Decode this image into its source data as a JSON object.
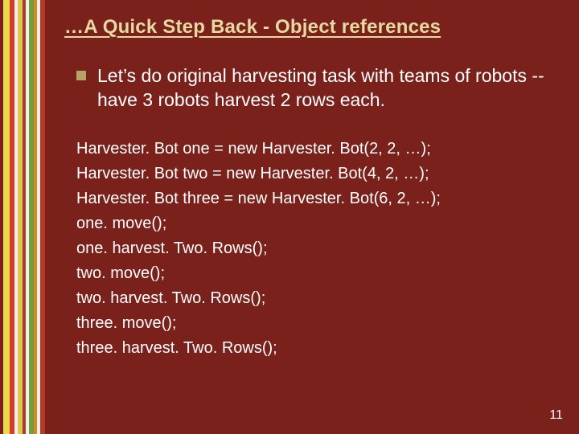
{
  "title": "…A Quick Step Back - Object references",
  "bullet": "Let’s do original harvesting task with teams of robots -- have 3 robots harvest 2 rows each.",
  "code": [
    "Harvester. Bot one = new Harvester. Bot(2, 2, …);",
    "Harvester. Bot two = new Harvester. Bot(4, 2, …);",
    "Harvester. Bot three = new Harvester. Bot(6, 2, …);",
    "one. move();",
    "one. harvest. Two. Rows();",
    "two. move();",
    "two. harvest. Two. Rows();",
    "three. move();",
    "three. harvest. Two. Rows();"
  ],
  "slide_number": "11",
  "stripes": [
    {
      "w": 4,
      "c": "#7a211b"
    },
    {
      "w": 8,
      "c": "#e8d94a"
    },
    {
      "w": 6,
      "c": "#d43b2a"
    },
    {
      "w": 4,
      "c": "#f4f0e6"
    },
    {
      "w": 6,
      "c": "#e0c84e"
    },
    {
      "w": 4,
      "c": "#a04028"
    },
    {
      "w": 4,
      "c": "#f4f0e6"
    },
    {
      "w": 6,
      "c": "#6fa03c"
    },
    {
      "w": 4,
      "c": "#d48a2a"
    },
    {
      "w": 4,
      "c": "#f4f0e6"
    },
    {
      "w": 6,
      "c": "#b23a2a"
    }
  ]
}
